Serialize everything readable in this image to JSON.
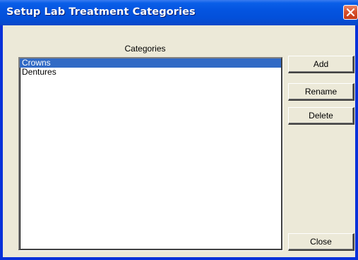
{
  "window": {
    "title": "Setup Lab Treatment Categories"
  },
  "categories": {
    "label": "Categories",
    "items": [
      "Crowns",
      "Dentures"
    ],
    "selected_index": 0
  },
  "buttons": {
    "add": "Add",
    "rename": "Rename",
    "delete": "Delete",
    "close": "Close"
  },
  "colors": {
    "title_bar": "#0454e0",
    "selection": "#316ac5",
    "close_button": "#d8502c",
    "dialog_face": "#ece9d8"
  }
}
